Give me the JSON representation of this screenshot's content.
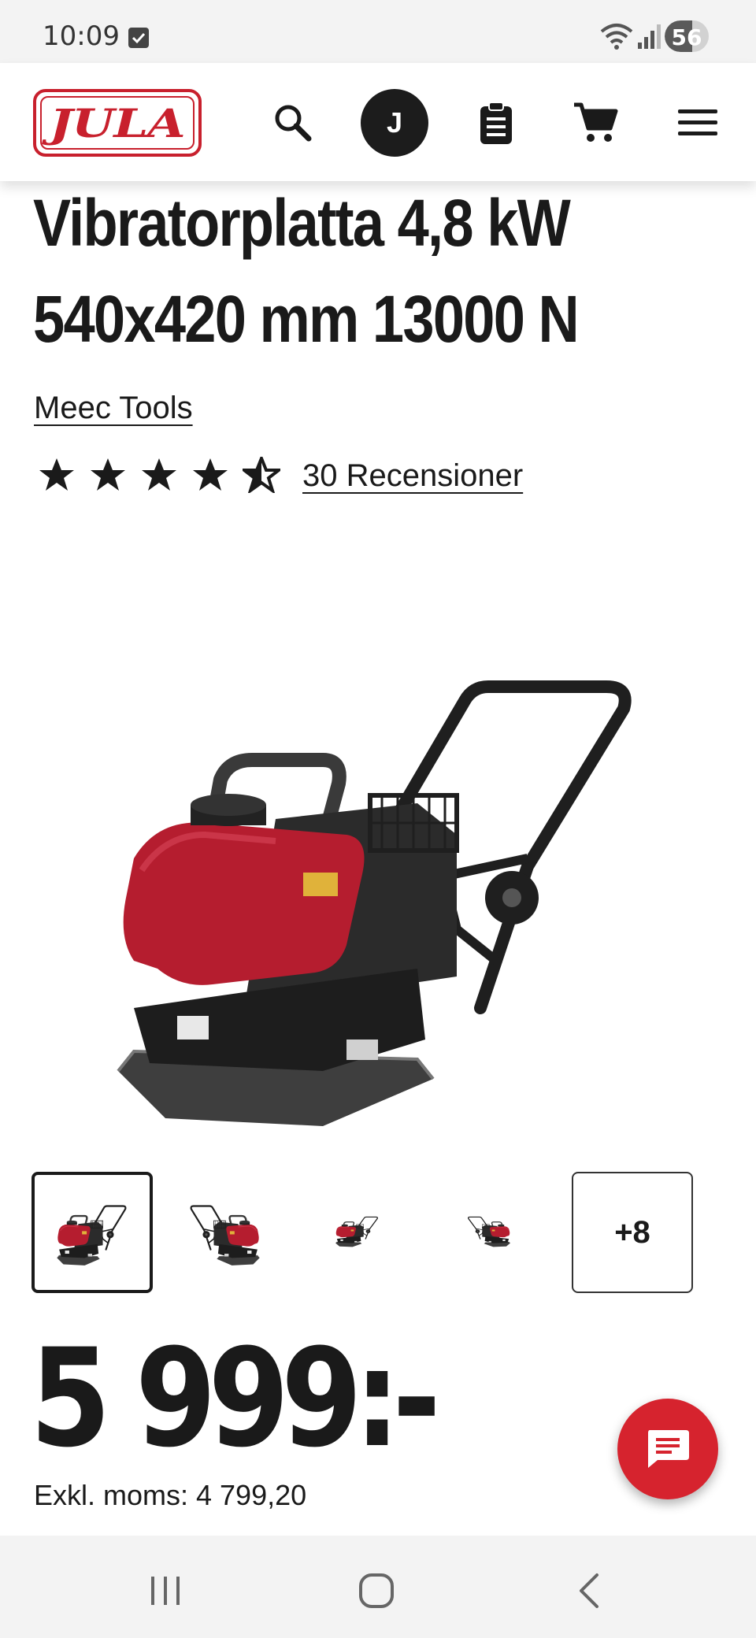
{
  "status_bar": {
    "time": "10:09",
    "battery": "56",
    "icons": [
      "checkbox-notification-icon",
      "wifi-icon",
      "signal-icon",
      "battery-icon"
    ]
  },
  "header": {
    "logo_text": "JULA",
    "avatar_initial": "J",
    "icons": [
      "search-icon",
      "account-avatar",
      "shopping-list-icon",
      "cart-icon",
      "menu-icon"
    ],
    "brand_color": "#c8202d"
  },
  "product": {
    "title_line1": "Vibratorplatta 4,8 kW",
    "title_line2": "540x420 mm 13000 N",
    "brand": "Meec Tools",
    "rating": 4.5,
    "rating_max": 5,
    "reviews_label": "30 Recensioner",
    "price": "5 999:-",
    "price_ex_vat": "Exkl. moms: 4 799,20"
  },
  "gallery": {
    "selected_index": 0,
    "thumbnails": [
      "front-view",
      "side-view",
      "low-angle-view",
      "rear-view"
    ],
    "more_label": "+8"
  },
  "chat": {
    "icon": "chat-icon",
    "color": "#d6232e"
  },
  "navigation": {
    "buttons": [
      "recent-apps-icon",
      "home-icon",
      "back-icon"
    ]
  }
}
